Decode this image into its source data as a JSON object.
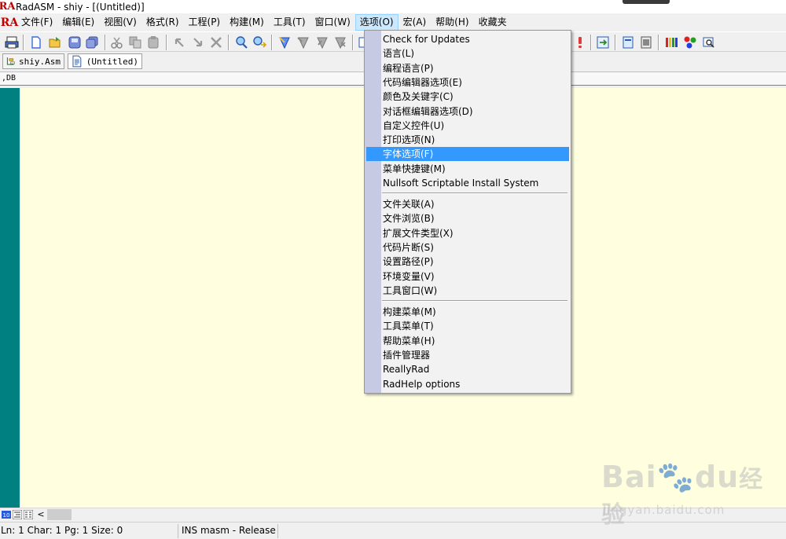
{
  "window": {
    "title": "RadASM - shiy - [(Untitled)]",
    "logo_text": "RA"
  },
  "menubar": {
    "items": [
      {
        "label": "文件(F)"
      },
      {
        "label": "编辑(E)"
      },
      {
        "label": "视图(V)"
      },
      {
        "label": "格式(R)"
      },
      {
        "label": "工程(P)"
      },
      {
        "label": "构建(M)"
      },
      {
        "label": "工具(T)"
      },
      {
        "label": "窗口(W)"
      },
      {
        "label": "选项(O)",
        "active": true
      },
      {
        "label": "宏(A)"
      },
      {
        "label": "帮助(H)"
      },
      {
        "label": "收藏夹"
      }
    ]
  },
  "toolbar": {
    "buttons": [
      "print-icon",
      "new-file-icon",
      "open-folder-icon",
      "save-icon",
      "save-all-icon",
      "cut-icon",
      "copy-icon",
      "paste-icon",
      "undo-icon",
      "redo-icon",
      "delete-icon",
      "find-icon",
      "replace-icon",
      "bookmark-toggle-icon",
      "bookmark-next-icon",
      "bookmark-prev-icon",
      "bookmark-clear-icon",
      "dialog-icon",
      "warning-icon",
      "export-icon",
      "project-icon",
      "properties-icon",
      "color-bars-icon",
      "color-dots-icon",
      "preview-icon"
    ]
  },
  "tabs": [
    {
      "label": "shiy.Asm",
      "icon": "project-tree-icon"
    },
    {
      "label": "(Untitled)",
      "icon": "document-icon"
    }
  ],
  "propbar": {
    "text": ",DB"
  },
  "options_menu": {
    "group1": [
      {
        "label": "Check for Updates"
      },
      {
        "label": "语言(L)"
      },
      {
        "label": "编程语言(P)"
      },
      {
        "label": "代码编辑器选项(E)"
      },
      {
        "label": "颜色及关键字(C)"
      },
      {
        "label": "对话框编辑器选项(D)"
      },
      {
        "label": "自定义控件(U)"
      },
      {
        "label": "打印选项(N)"
      },
      {
        "label": "字体选项(F)",
        "highlighted": true
      },
      {
        "label": "菜单快捷键(M)"
      },
      {
        "label": "Nullsoft Scriptable Install System"
      }
    ],
    "group2": [
      {
        "label": "文件关联(A)"
      },
      {
        "label": "文件浏览(B)"
      },
      {
        "label": "扩展文件类型(X)"
      },
      {
        "label": "代码片断(S)"
      },
      {
        "label": "设置路径(P)"
      },
      {
        "label": "环境变量(V)"
      },
      {
        "label": "工具窗口(W)"
      }
    ],
    "group3": [
      {
        "label": "构建菜单(M)"
      },
      {
        "label": "工具菜单(T)"
      },
      {
        "label": "帮助菜单(H)"
      },
      {
        "label": "插件管理器"
      },
      {
        "label": "ReallyRad"
      },
      {
        "label": "RadHelp options"
      }
    ]
  },
  "statusbar": {
    "position": "Ln: 1 Char: 1 Pg: 1 Size: 0",
    "mode": "INS masm - Release"
  },
  "watermark": {
    "brand": "Bai",
    "brand_suffix": "du",
    "brand_cn": "经验",
    "url": "jingyan.baidu.com"
  },
  "colors": {
    "editor_bg": "#ffffe0",
    "gutter": "#008080",
    "menu_highlight": "#3399ff",
    "menu_strip": "#c6cbe3",
    "active_menu": "#cce8ff"
  }
}
